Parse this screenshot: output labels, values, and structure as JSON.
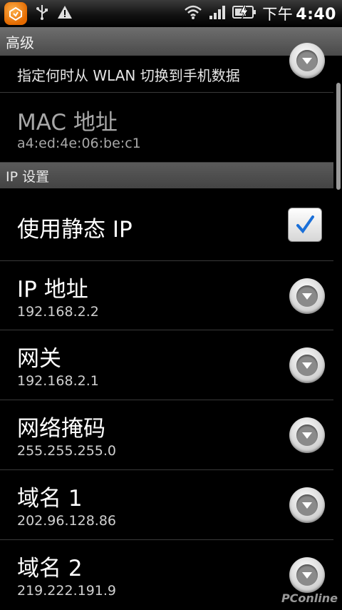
{
  "status_bar": {
    "icons_left": [
      "app-badge-icon",
      "usb-icon",
      "warning-icon"
    ],
    "icons_right": [
      "wifi-icon",
      "signal-icon",
      "battery-charging-icon"
    ],
    "time_ampm": "下午",
    "time": "4:40"
  },
  "title_bar": {
    "title": "高级"
  },
  "rows": {
    "switch_policy": {
      "subtitle": "指定何时从 WLAN 切换到手机数据"
    },
    "mac": {
      "title": "MAC 地址",
      "subtitle": "a4:ed:4e:06:be:c1"
    },
    "ip_section": {
      "label": "IP 设置"
    },
    "static_ip": {
      "title": "使用静态 IP",
      "checked": true
    },
    "ip_address": {
      "title": "IP 地址",
      "value": "192.168.2.2"
    },
    "gateway": {
      "title": "网关",
      "value": "192.168.2.1"
    },
    "netmask": {
      "title": "网络掩码",
      "value": "255.255.255.0"
    },
    "dns1": {
      "title": "域名 1",
      "value": "202.96.128.86"
    },
    "dns2": {
      "title": "域名 2",
      "value": "219.222.191.9"
    }
  },
  "watermark": {
    "text": "PConline"
  },
  "colors": {
    "accent_check": "#1a6fd8"
  }
}
